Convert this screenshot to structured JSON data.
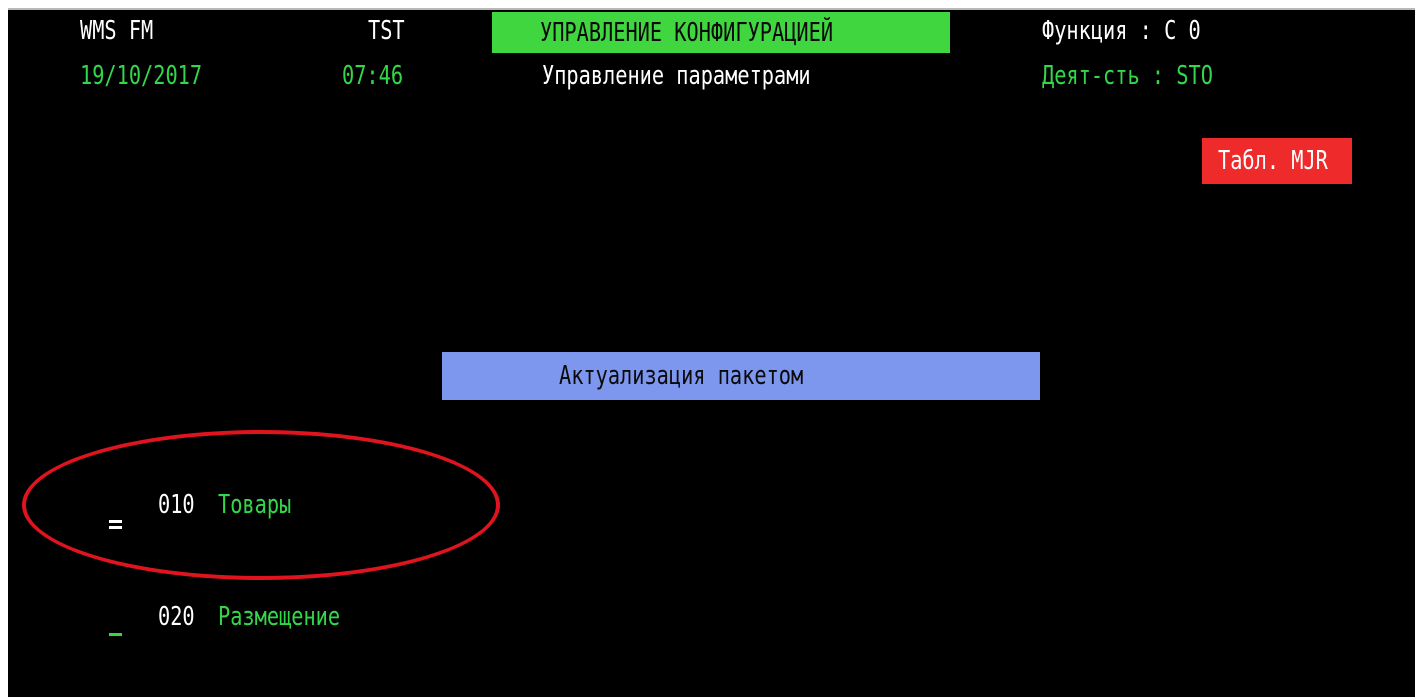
{
  "header": {
    "system": "WMS FM",
    "environment": "TST",
    "date": "19/10/2017",
    "time": "07:46",
    "title": "УПРАВЛЕНИЕ КОНФИГУРАЦИЕЙ",
    "subtitle": "Управление параметрами",
    "function_label": "Функция : C 0",
    "activity_label": "Деят-сть : STO",
    "table_badge": "Табл. MJR"
  },
  "section_title": "Актуализация пакетом",
  "menu_items": [
    {
      "code": "010",
      "label": "Товары",
      "cursor": "="
    },
    {
      "code": "020",
      "label": "Размещение",
      "cursor": "_"
    }
  ],
  "colors": {
    "background": "#000000",
    "title_bar": "#3fd63f",
    "badge": "#ee2a2a",
    "section_bar": "#7d96ee",
    "green_text": "#33d84a",
    "annotation": "#e0141e"
  }
}
